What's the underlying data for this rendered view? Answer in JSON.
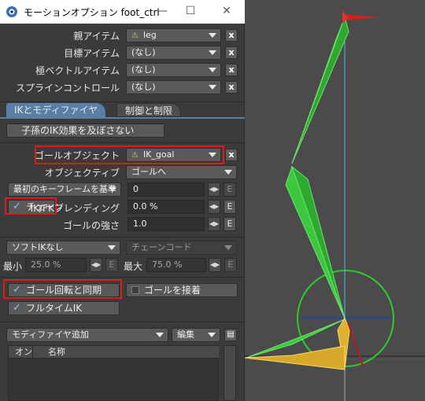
{
  "window": {
    "title": "モーションオプション foot_ctrl",
    "minimize": "—",
    "maximize": "☐",
    "close": "✕"
  },
  "fields": {
    "parent_label": "親アイテム",
    "parent_value": "leg",
    "target_label": "目標アイテム",
    "target_value": "(なし)",
    "pole_label": "極ベクトルアイテム",
    "pole_value": "(なし)",
    "spline_label": "スプラインコントロール",
    "spline_value": "(なし)",
    "x": "x"
  },
  "tabs": {
    "ik": "IKとモディファイヤ",
    "control": "制御と制限"
  },
  "ik": {
    "no_child_ik": "子孫のIK効果を及ぼさない",
    "goal_object_label": "ゴールオブジェクト",
    "goal_object_value": "IK_goal",
    "objective_label": "オブジェクティブ",
    "objective_value": "ゴールへ",
    "first_key_value": "最初のキーフレームを基準",
    "first_key_number": "0",
    "chain_label": "チェーン",
    "blend_label": "IK/FKブレンディング",
    "blend_value": "0.0 %",
    "goal_strength_label": "ゴールの強さ",
    "goal_strength_value": "1.0",
    "soft_ik_value": "ソフトIKなし",
    "chain_code_value": "チェーンコード",
    "min_label": "最小",
    "min_value": "25.0 %",
    "max_label": "最大",
    "max_value": "75.0 %",
    "sync_goal_rotation": "ゴール回転と同期",
    "stick_to_goal": "ゴールを接着",
    "full_time_ik": "フルタイムIK",
    "e": "E"
  },
  "modifier": {
    "add_label": "モディファイヤ追加",
    "edit_label": "編集",
    "col_on": "オン",
    "col_name": "名称"
  },
  "colors": {
    "accent": "#5a7fa5",
    "highlight": "#d81b1b",
    "bone": "#3cc83c",
    "goal_bone": "#e0b030",
    "circle": "#2ecb2e"
  }
}
